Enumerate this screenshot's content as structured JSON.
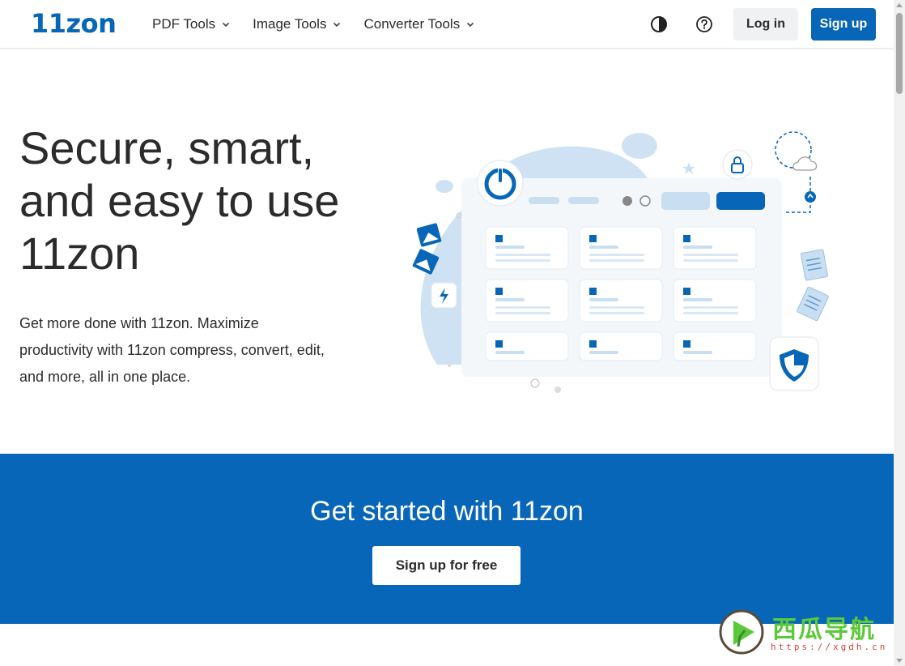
{
  "header": {
    "logo": "11zon",
    "nav": [
      {
        "label": "PDF Tools"
      },
      {
        "label": "Image Tools"
      },
      {
        "label": "Converter Tools"
      }
    ],
    "theme_icon": "contrast-icon",
    "help_icon": "help-icon",
    "login_label": "Log in",
    "signup_label": "Sign up"
  },
  "hero": {
    "title": "Secure, smart, and easy to use 11zon",
    "subtitle": "Get more done with 11zon. Maximize productivity with 11zon compress, convert, edit, and more, all in one place."
  },
  "cta": {
    "title": "Get started with 11zon",
    "button_label": "Sign up for free"
  },
  "watermark": {
    "text": "西瓜导航",
    "url": "https://xgdh.cn"
  },
  "colors": {
    "brand": "#0866b9",
    "light_blue": "#c9dff1"
  }
}
